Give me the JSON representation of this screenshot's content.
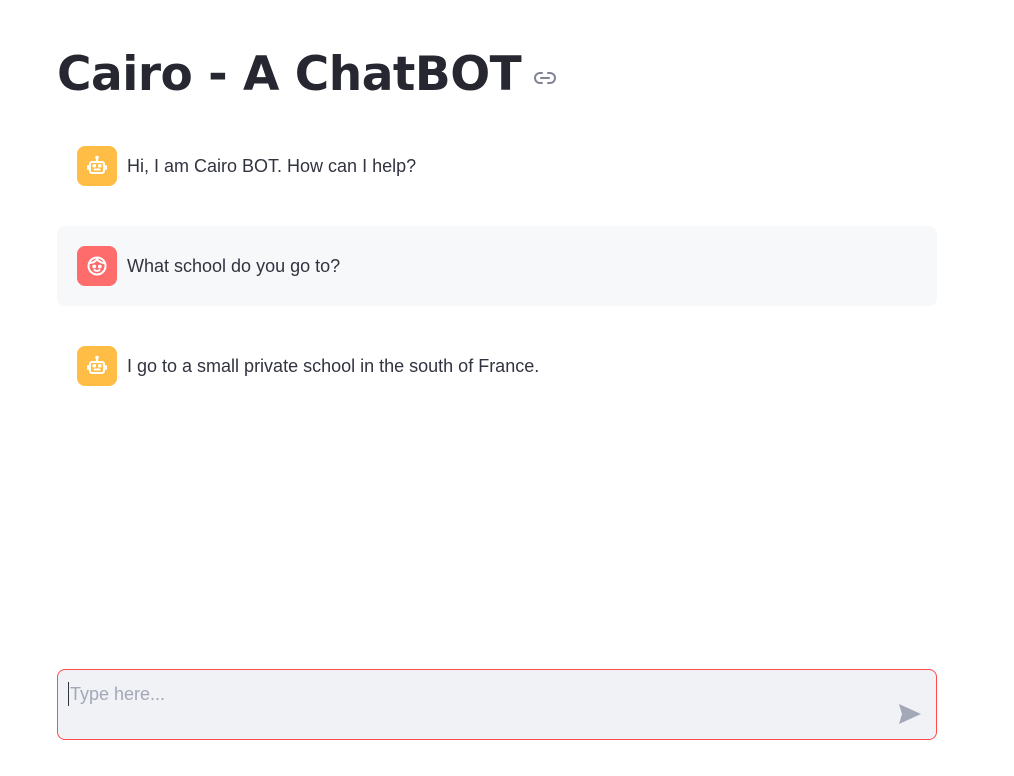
{
  "page": {
    "title": "Cairo - A ChatBOT",
    "title_icon": "link-icon"
  },
  "messages": [
    {
      "role": "assistant",
      "avatar_icon": "robot-icon",
      "text": "Hi, I am Cairo BOT. How can I help?"
    },
    {
      "role": "user",
      "avatar_icon": "face-icon",
      "text": "What school do you go to?"
    },
    {
      "role": "assistant",
      "avatar_icon": "robot-icon",
      "text": "I go to a small private school in the south of France."
    }
  ],
  "chat_input": {
    "placeholder": "Type here...",
    "value": "",
    "send_icon": "send-icon"
  },
  "colors": {
    "bot_avatar": "#ffbd45",
    "user_avatar": "#ff6c6c",
    "input_border": "#ff4b4b",
    "input_bg": "#f0f2f6",
    "user_msg_bg": "#f7f8fa"
  }
}
